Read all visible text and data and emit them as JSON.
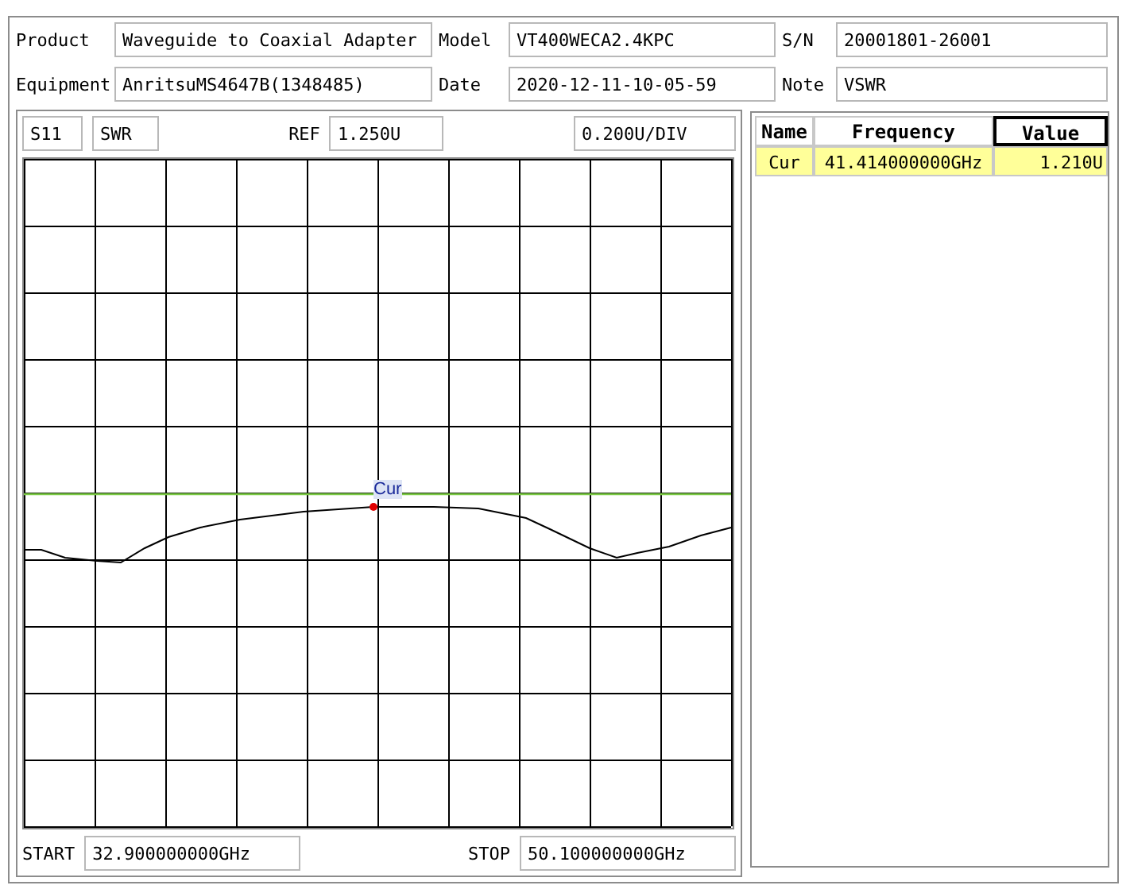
{
  "header": [
    {
      "label": "Product",
      "value": "Waveguide to Coaxial Adapter"
    },
    {
      "label": "Model",
      "value": "VT400WECA2.4KPC"
    },
    {
      "label": "S/N",
      "value": "20001801-26001"
    },
    {
      "label": "Equipment",
      "value": "AnritsuMS4647B(1348485)"
    },
    {
      "label": "Date",
      "value": "2020-12-11-10-05-59"
    },
    {
      "label": "Note",
      "value": "VSWR"
    }
  ],
  "plot": {
    "param": "S11",
    "format": "SWR",
    "ref_label": "REF",
    "ref_value": "1.250U",
    "scale": "0.200U/DIV",
    "marker_label": "Cur",
    "start_label": "START",
    "start_value": "32.900000000GHz",
    "stop_label": "STOP",
    "stop_value": "50.100000000GHz"
  },
  "marker_table": {
    "columns": [
      {
        "label": "Name",
        "selected": false
      },
      {
        "label": "Frequency",
        "selected": false
      },
      {
        "label": "Value",
        "selected": true
      }
    ],
    "rows": [
      {
        "cells": [
          "Cur",
          "41.414000000GHz",
          "1.210U"
        ],
        "selected": true
      }
    ]
  }
}
